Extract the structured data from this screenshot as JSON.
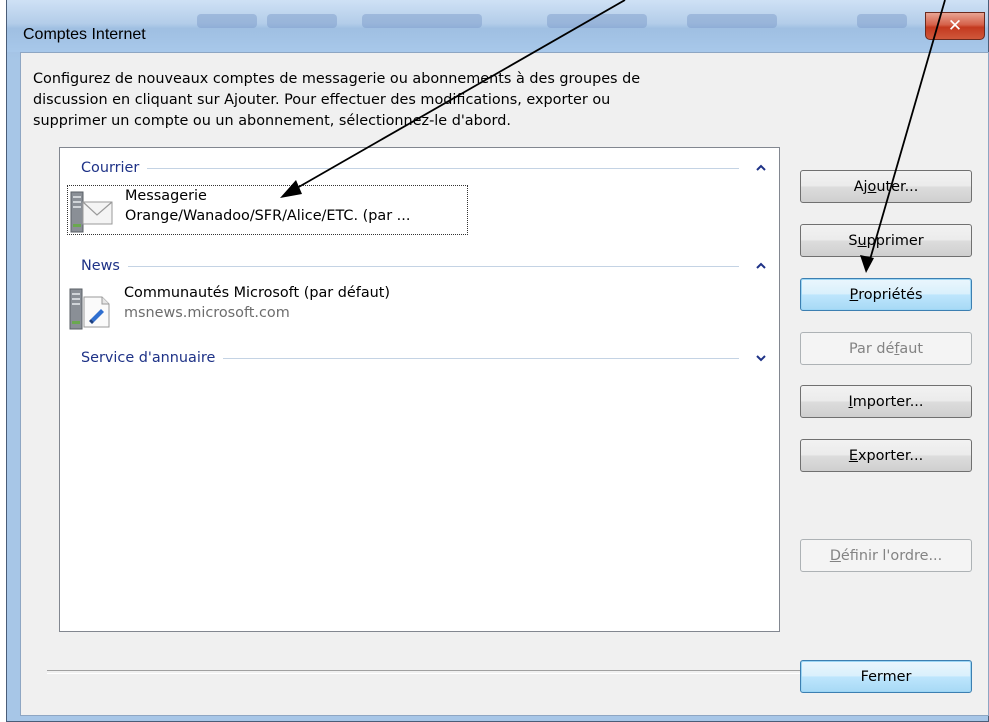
{
  "window": {
    "title": "Comptes Internet"
  },
  "intro": {
    "line1": "Configurez de nouveaux comptes de messagerie ou abonnements à des groupes de",
    "line2": "discussion en cliquant sur Ajouter. Pour effectuer des modifications, exporter ou",
    "line3": "supprimer un compte ou un abonnement, sélectionnez-le d'abord."
  },
  "groups": {
    "mail": {
      "label": "Courrier"
    },
    "news": {
      "label": "News"
    },
    "directory": {
      "label": "Service d'annuaire"
    }
  },
  "accounts": {
    "mail": {
      "name": "Messagerie",
      "detail": "Orange/Wanadoo/SFR/Alice/ETC. (par ..."
    },
    "news": {
      "name": "Communautés Microsoft (par défaut)",
      "detail": "msnews.microsoft.com"
    }
  },
  "buttons": {
    "add": {
      "before": "Aj",
      "key": "o",
      "after": "uter..."
    },
    "remove": {
      "before": "S",
      "key": "u",
      "after": "pprimer"
    },
    "properties": {
      "before": "",
      "key": "P",
      "after": "ropriétés"
    },
    "default": {
      "before": "Par dé",
      "key": "f",
      "after": "aut"
    },
    "import": {
      "before": "",
      "key": "I",
      "after": "mporter..."
    },
    "export": {
      "before": "",
      "key": "E",
      "after": "xporter..."
    },
    "order": {
      "before": "",
      "key": "D",
      "after": "éfinir l'ordre..."
    },
    "close": "Fermer"
  },
  "icons": {
    "close": "close-icon",
    "collapse": "chevron-up-icon",
    "expand": "chevron-down-icon",
    "mail": "mail-server-icon",
    "news": "news-server-icon"
  },
  "colors": {
    "group_label": "#1e3287",
    "focused_button": "#a7d9f5",
    "close_button": "#c3391f"
  }
}
